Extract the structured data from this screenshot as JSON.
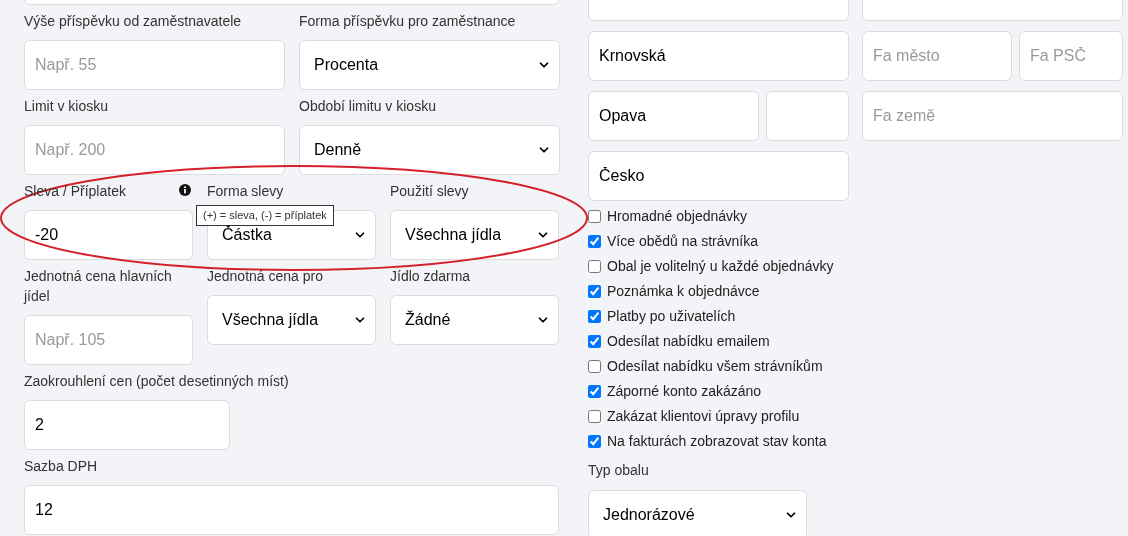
{
  "left_rows": [
    {
      "fields": [
        {
          "label": "Výše příspěvku od zaměstnavatele",
          "kind": "input",
          "placeholder": "Např. 55"
        },
        {
          "label": "Forma příspěvku pro zaměstnance",
          "kind": "select",
          "value": "Procenta"
        }
      ]
    },
    {
      "fields": [
        {
          "label": "Limit v kiosku",
          "kind": "input",
          "placeholder": "Např. 200"
        },
        {
          "label": "Období limitu v kiosku",
          "kind": "select",
          "value": "Denně"
        }
      ]
    },
    {
      "fields": [
        {
          "label": "Sleva / Příplatek",
          "kind": "input",
          "value": "-20",
          "tooltip": "(+) = sleva, (-) = příplatek"
        },
        {
          "label": "Forma slevy",
          "kind": "select",
          "value": "Částka"
        },
        {
          "label": "Použití slevy",
          "kind": "select",
          "value": "Všechna jídla"
        }
      ]
    },
    {
      "fields": [
        {
          "label": "Jednotná cena hlavních jídel",
          "kind": "input",
          "placeholder": "Např. 105"
        },
        {
          "label": "Jednotná cena pro",
          "kind": "select",
          "value": "Všechna jídla"
        },
        {
          "label": "Jídlo zdarma",
          "kind": "select",
          "value": "Žádné"
        }
      ]
    },
    {
      "fields": [
        {
          "label": "Zaokrouhlení cen (počet desetinných míst)",
          "kind": "input",
          "value": "2"
        }
      ]
    },
    {
      "fields": [
        {
          "label": "Sazba DPH",
          "kind": "input",
          "value": "12"
        }
      ]
    }
  ],
  "address_rows": [
    {
      "fields": [
        {
          "kind": "input",
          "value": "Krnovská"
        },
        {
          "kind": "input",
          "placeholder": "Fa město"
        },
        {
          "kind": "input",
          "placeholder": "Fa PSČ"
        }
      ]
    },
    {
      "fields": [
        {
          "kind": "input",
          "value": "Opava"
        },
        {
          "kind": "input"
        },
        {
          "kind": "input",
          "placeholder": "Fa země"
        }
      ]
    },
    {
      "fields": [
        {
          "kind": "input",
          "value": "Česko"
        }
      ]
    }
  ],
  "options": [
    {
      "label": "Hromadné objednávky",
      "checked": false
    },
    {
      "label": "Více obědů na strávníka",
      "checked": true
    },
    {
      "label": "Obal je volitelný u každé objednávky",
      "checked": false
    },
    {
      "label": "Poznámka k objednávce",
      "checked": true
    },
    {
      "label": "Platby po uživatelích",
      "checked": true
    },
    {
      "label": "Odesílat nabídku emailem",
      "checked": true
    },
    {
      "label": "Odesílat nabídku všem strávníkům",
      "checked": false
    },
    {
      "label": "Záporné konto zakázáno",
      "checked": true
    },
    {
      "label": "Zakázat klientovi úpravy profilu",
      "checked": false
    },
    {
      "label": "Na fakturách zobrazovat stav konta",
      "checked": true
    }
  ],
  "packaging": {
    "label": "Typ obalu",
    "kind": "select",
    "value": "Jednorázové"
  },
  "annotation": {
    "kind": "ellipse"
  }
}
